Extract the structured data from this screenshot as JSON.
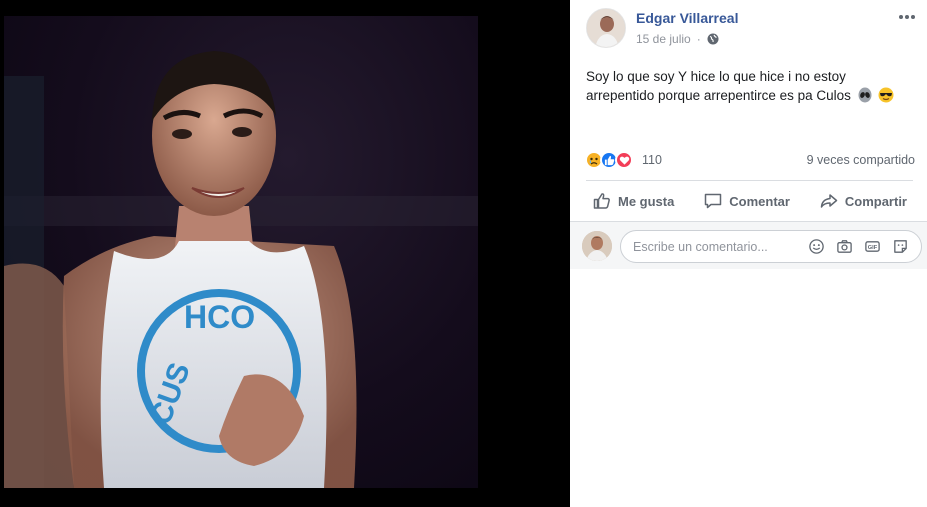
{
  "post": {
    "author": "Edgar Villarreal",
    "date": "15 de julio",
    "text": "Soy lo que soy Y hice lo que hice i no estoy arrepentido porque arrepentirce es pa Culos",
    "emojis": [
      "alien-emoji",
      "sunglasses-emoji"
    ]
  },
  "reactions": {
    "types": [
      "sad",
      "like",
      "love"
    ],
    "count": "110",
    "shares": "9 veces compartido"
  },
  "actions": {
    "like": "Me gusta",
    "comment": "Comentar",
    "share": "Compartir"
  },
  "comment_box": {
    "placeholder": "Escribe un comentario...",
    "tools": [
      "emoji-icon",
      "camera-icon",
      "gif-icon",
      "sticker-icon"
    ]
  },
  "colors": {
    "author_link": "#385898",
    "like_blue": "#1877f2",
    "love_red": "#f33e58",
    "sad_yellow": "#f7b125"
  }
}
